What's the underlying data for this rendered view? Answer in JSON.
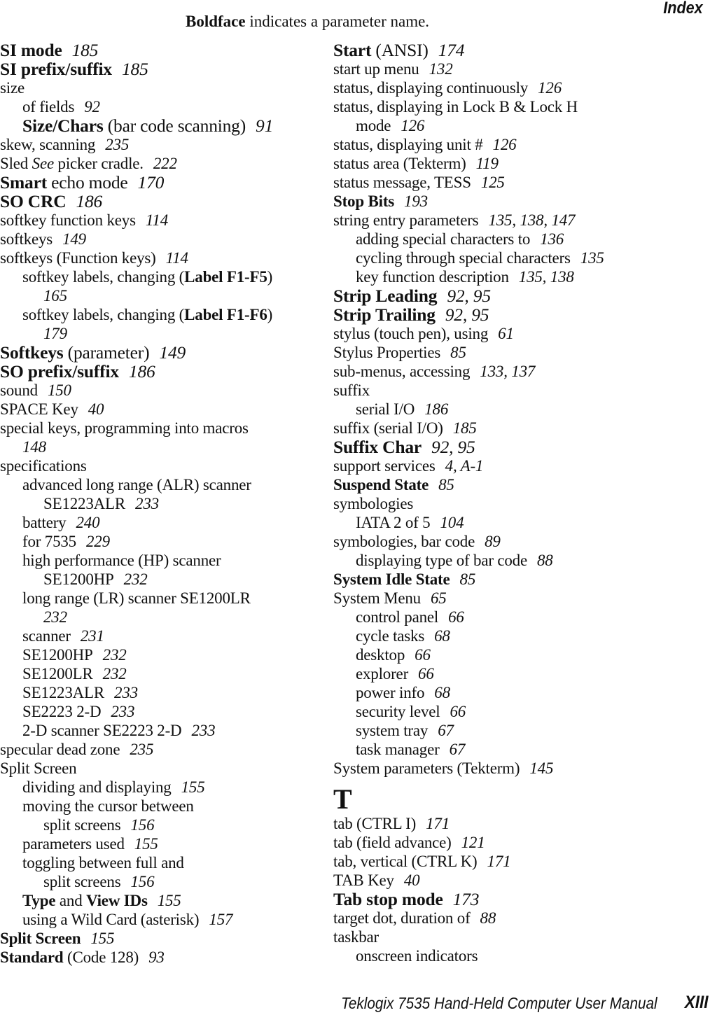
{
  "header": {
    "section_title": "Index"
  },
  "legend": {
    "bold_word": "Boldface",
    "rest": " indicates a parameter name."
  },
  "left_column": [
    {
      "level": 0,
      "large": true,
      "parts": [
        {
          "t": "SI mode",
          "b": true
        }
      ],
      "pages": "185"
    },
    {
      "level": 0,
      "large": true,
      "parts": [
        {
          "t": "SI prefix/suffix",
          "b": true
        }
      ],
      "pages": "185"
    },
    {
      "level": 0,
      "parts": [
        {
          "t": "size"
        }
      ],
      "pages": ""
    },
    {
      "level": 1,
      "parts": [
        {
          "t": "of fields"
        }
      ],
      "pages": "92"
    },
    {
      "level": 1,
      "large": true,
      "parts": [
        {
          "t": "Size/Chars",
          "b": true
        },
        {
          "t": " (bar code scanning)"
        }
      ],
      "pages": "91"
    },
    {
      "level": 0,
      "parts": [
        {
          "t": "skew, scanning"
        }
      ],
      "pages": "235"
    },
    {
      "level": 0,
      "parts": [
        {
          "t": "Sled "
        },
        {
          "t": "See",
          "i": true
        },
        {
          "t": " picker cradle."
        }
      ],
      "pages": "222"
    },
    {
      "level": 0,
      "large": true,
      "parts": [
        {
          "t": "Smart",
          "b": true
        },
        {
          "t": " echo mode"
        }
      ],
      "pages": "170"
    },
    {
      "level": 0,
      "large": true,
      "parts": [
        {
          "t": "SO CRC",
          "b": true
        }
      ],
      "pages": "186"
    },
    {
      "level": 0,
      "parts": [
        {
          "t": "softkey function keys"
        }
      ],
      "pages": "114"
    },
    {
      "level": 0,
      "parts": [
        {
          "t": "softkeys"
        }
      ],
      "pages": "149"
    },
    {
      "level": 0,
      "parts": [
        {
          "t": "softkeys (Function keys)"
        }
      ],
      "pages": "114"
    },
    {
      "level": 1,
      "parts": [
        {
          "t": "softkey labels, changing ("
        },
        {
          "t": "Label F1-F5",
          "b": true
        },
        {
          "t": ")"
        }
      ],
      "pages": ""
    },
    {
      "level": 2,
      "parts": [],
      "pages": "165"
    },
    {
      "level": 1,
      "parts": [
        {
          "t": "softkey labels, changing ("
        },
        {
          "t": "Label F1-F6",
          "b": true
        },
        {
          "t": ")"
        }
      ],
      "pages": ""
    },
    {
      "level": 2,
      "parts": [],
      "pages": "179"
    },
    {
      "level": 0,
      "large": true,
      "parts": [
        {
          "t": "Softkeys",
          "b": true
        },
        {
          "t": " (parameter)"
        }
      ],
      "pages": "149"
    },
    {
      "level": 0,
      "large": true,
      "parts": [
        {
          "t": "SO prefix/suffix",
          "b": true
        }
      ],
      "pages": "186"
    },
    {
      "level": 0,
      "parts": [
        {
          "t": "sound"
        }
      ],
      "pages": "150"
    },
    {
      "level": 0,
      "parts": [
        {
          "t": "SPACE Key"
        }
      ],
      "pages": "40"
    },
    {
      "level": 0,
      "parts": [
        {
          "t": "special keys, programming into macros"
        }
      ],
      "pages": ""
    },
    {
      "level": 1,
      "parts": [],
      "pages": "148"
    },
    {
      "level": 0,
      "parts": [
        {
          "t": "specifications"
        }
      ],
      "pages": ""
    },
    {
      "level": 1,
      "parts": [
        {
          "t": "advanced long range (ALR) scanner"
        }
      ],
      "pages": ""
    },
    {
      "level": 2,
      "parts": [
        {
          "t": "SE1223ALR"
        }
      ],
      "pages": "233"
    },
    {
      "level": 1,
      "parts": [
        {
          "t": "battery"
        }
      ],
      "pages": "240"
    },
    {
      "level": 1,
      "parts": [
        {
          "t": "for 7535"
        }
      ],
      "pages": "229"
    },
    {
      "level": 1,
      "parts": [
        {
          "t": "high performance (HP) scanner"
        }
      ],
      "pages": ""
    },
    {
      "level": 2,
      "parts": [
        {
          "t": "SE1200HP"
        }
      ],
      "pages": "232"
    },
    {
      "level": 1,
      "parts": [
        {
          "t": "long range (LR) scanner SE1200LR"
        }
      ],
      "pages": ""
    },
    {
      "level": 2,
      "parts": [],
      "pages": "232"
    },
    {
      "level": 1,
      "parts": [
        {
          "t": "scanner"
        }
      ],
      "pages": "231"
    },
    {
      "level": 1,
      "parts": [
        {
          "t": "SE1200HP"
        }
      ],
      "pages": "232"
    },
    {
      "level": 1,
      "parts": [
        {
          "t": "SE1200LR"
        }
      ],
      "pages": "232"
    },
    {
      "level": 1,
      "parts": [
        {
          "t": "SE1223ALR"
        }
      ],
      "pages": "233"
    },
    {
      "level": 1,
      "parts": [
        {
          "t": "SE2223 2-D"
        }
      ],
      "pages": "233"
    },
    {
      "level": 1,
      "parts": [
        {
          "t": "2-D scanner SE2223 2-D"
        }
      ],
      "pages": "233"
    },
    {
      "level": 0,
      "parts": [
        {
          "t": "specular dead zone"
        }
      ],
      "pages": "235"
    },
    {
      "level": 0,
      "parts": [
        {
          "t": "Split Screen"
        }
      ],
      "pages": ""
    },
    {
      "level": 1,
      "parts": [
        {
          "t": "dividing and displaying"
        }
      ],
      "pages": "155"
    },
    {
      "level": 1,
      "parts": [
        {
          "t": "moving the cursor between"
        }
      ],
      "pages": ""
    },
    {
      "level": 2,
      "parts": [
        {
          "t": "split screens"
        }
      ],
      "pages": "156"
    },
    {
      "level": 1,
      "parts": [
        {
          "t": "parameters used"
        }
      ],
      "pages": "155"
    },
    {
      "level": 1,
      "parts": [
        {
          "t": "toggling between full and"
        }
      ],
      "pages": ""
    },
    {
      "level": 2,
      "parts": [
        {
          "t": "split screens"
        }
      ],
      "pages": "156"
    },
    {
      "level": 1,
      "parts": [
        {
          "t": "Type",
          "b": true
        },
        {
          "t": " and "
        },
        {
          "t": "View IDs",
          "b": true
        }
      ],
      "pages": "155"
    },
    {
      "level": 1,
      "parts": [
        {
          "t": "using a Wild Card (asterisk)"
        }
      ],
      "pages": "157"
    },
    {
      "level": 0,
      "parts": [
        {
          "t": "Split Screen",
          "b": true
        }
      ],
      "pages": "155"
    },
    {
      "level": 0,
      "parts": [
        {
          "t": "Standard",
          "b": true
        },
        {
          "t": " (Code 128)"
        }
      ],
      "pages": "93"
    }
  ],
  "right_column": [
    {
      "level": 0,
      "large": true,
      "parts": [
        {
          "t": "Start",
          "b": true
        },
        {
          "t": " (ANSI)"
        }
      ],
      "pages": "174"
    },
    {
      "level": 0,
      "parts": [
        {
          "t": "start up menu"
        }
      ],
      "pages": "132"
    },
    {
      "level": 0,
      "parts": [
        {
          "t": "status, displaying continuously"
        }
      ],
      "pages": "126"
    },
    {
      "level": 0,
      "parts": [
        {
          "t": "status, displaying in Lock B & Lock H"
        }
      ],
      "pages": ""
    },
    {
      "level": 1,
      "parts": [
        {
          "t": "mode"
        }
      ],
      "pages": "126"
    },
    {
      "level": 0,
      "parts": [
        {
          "t": "status, displaying unit #"
        }
      ],
      "pages": "126"
    },
    {
      "level": 0,
      "parts": [
        {
          "t": "status area (Tekterm)"
        }
      ],
      "pages": "119"
    },
    {
      "level": 0,
      "parts": [
        {
          "t": "status message, TESS"
        }
      ],
      "pages": "125"
    },
    {
      "level": 0,
      "parts": [
        {
          "t": "Stop Bits",
          "b": true
        }
      ],
      "pages": "193"
    },
    {
      "level": 0,
      "parts": [
        {
          "t": "string entry parameters"
        }
      ],
      "pages": "135, 138, 147"
    },
    {
      "level": 1,
      "parts": [
        {
          "t": "adding special characters to"
        }
      ],
      "pages": "136"
    },
    {
      "level": 1,
      "parts": [
        {
          "t": "cycling through special characters"
        }
      ],
      "pages": "135"
    },
    {
      "level": 1,
      "parts": [
        {
          "t": "key function description"
        }
      ],
      "pages": "135, 138"
    },
    {
      "level": 0,
      "large": true,
      "parts": [
        {
          "t": "Strip Leading",
          "b": true
        }
      ],
      "pages": "92, 95"
    },
    {
      "level": 0,
      "large": true,
      "parts": [
        {
          "t": "Strip Trailing",
          "b": true
        }
      ],
      "pages": "92, 95"
    },
    {
      "level": 0,
      "parts": [
        {
          "t": "stylus (touch pen), using"
        }
      ],
      "pages": "61"
    },
    {
      "level": 0,
      "parts": [
        {
          "t": "Stylus Properties"
        }
      ],
      "pages": "85"
    },
    {
      "level": 0,
      "parts": [
        {
          "t": "sub-menus, accessing"
        }
      ],
      "pages": "133, 137"
    },
    {
      "level": 0,
      "parts": [
        {
          "t": "suffix"
        }
      ],
      "pages": ""
    },
    {
      "level": 1,
      "parts": [
        {
          "t": "serial I/O"
        }
      ],
      "pages": "186"
    },
    {
      "level": 0,
      "parts": [
        {
          "t": "suffix (serial I/O)"
        }
      ],
      "pages": "185"
    },
    {
      "level": 0,
      "large": true,
      "parts": [
        {
          "t": "Suffix Char",
          "b": true
        }
      ],
      "pages": "92, 95"
    },
    {
      "level": 0,
      "parts": [
        {
          "t": "support services"
        }
      ],
      "pages": "4, A-1"
    },
    {
      "level": 0,
      "parts": [
        {
          "t": "Suspend State",
          "b": true
        }
      ],
      "pages": "85"
    },
    {
      "level": 0,
      "parts": [
        {
          "t": "symbologies"
        }
      ],
      "pages": ""
    },
    {
      "level": 1,
      "parts": [
        {
          "t": "IATA 2 of 5"
        }
      ],
      "pages": "104"
    },
    {
      "level": 0,
      "parts": [
        {
          "t": "symbologies, bar code"
        }
      ],
      "pages": "89"
    },
    {
      "level": 1,
      "parts": [
        {
          "t": "displaying type of bar code"
        }
      ],
      "pages": "88"
    },
    {
      "level": 0,
      "parts": [
        {
          "t": "System Idle State",
          "b": true
        }
      ],
      "pages": "85"
    },
    {
      "level": 0,
      "parts": [
        {
          "t": "System Menu"
        }
      ],
      "pages": "65"
    },
    {
      "level": 1,
      "parts": [
        {
          "t": "control panel"
        }
      ],
      "pages": "66"
    },
    {
      "level": 1,
      "parts": [
        {
          "t": "cycle tasks"
        }
      ],
      "pages": "68"
    },
    {
      "level": 1,
      "parts": [
        {
          "t": "desktop"
        }
      ],
      "pages": "66"
    },
    {
      "level": 1,
      "parts": [
        {
          "t": "explorer"
        }
      ],
      "pages": "66"
    },
    {
      "level": 1,
      "parts": [
        {
          "t": "power info"
        }
      ],
      "pages": "68"
    },
    {
      "level": 1,
      "parts": [
        {
          "t": "security level"
        }
      ],
      "pages": "66"
    },
    {
      "level": 1,
      "parts": [
        {
          "t": "system tray"
        }
      ],
      "pages": "67"
    },
    {
      "level": 1,
      "parts": [
        {
          "t": "task manager"
        }
      ],
      "pages": "67"
    },
    {
      "level": 0,
      "parts": [
        {
          "t": "System parameters (Tekterm)"
        }
      ],
      "pages": "145"
    },
    {
      "letter": "T"
    },
    {
      "level": 0,
      "parts": [
        {
          "t": "tab (CTRL I)"
        }
      ],
      "pages": "171"
    },
    {
      "level": 0,
      "parts": [
        {
          "t": "tab (field advance)"
        }
      ],
      "pages": "121"
    },
    {
      "level": 0,
      "parts": [
        {
          "t": "tab, vertical (CTRL K)"
        }
      ],
      "pages": "171"
    },
    {
      "level": 0,
      "parts": [
        {
          "t": "TAB Key"
        }
      ],
      "pages": "40"
    },
    {
      "level": 0,
      "large": true,
      "parts": [
        {
          "t": "Tab stop mode",
          "b": true
        }
      ],
      "pages": "173"
    },
    {
      "level": 0,
      "parts": [
        {
          "t": "target dot, duration of"
        }
      ],
      "pages": "88"
    },
    {
      "level": 0,
      "parts": [
        {
          "t": "taskbar"
        }
      ],
      "pages": ""
    },
    {
      "level": 1,
      "parts": [
        {
          "t": "onscreen indicators"
        }
      ],
      "pages": ""
    }
  ],
  "footer": {
    "manual_title": "Teklogix 7535 Hand-Held Computer User Manual",
    "page_number": "XIII"
  }
}
